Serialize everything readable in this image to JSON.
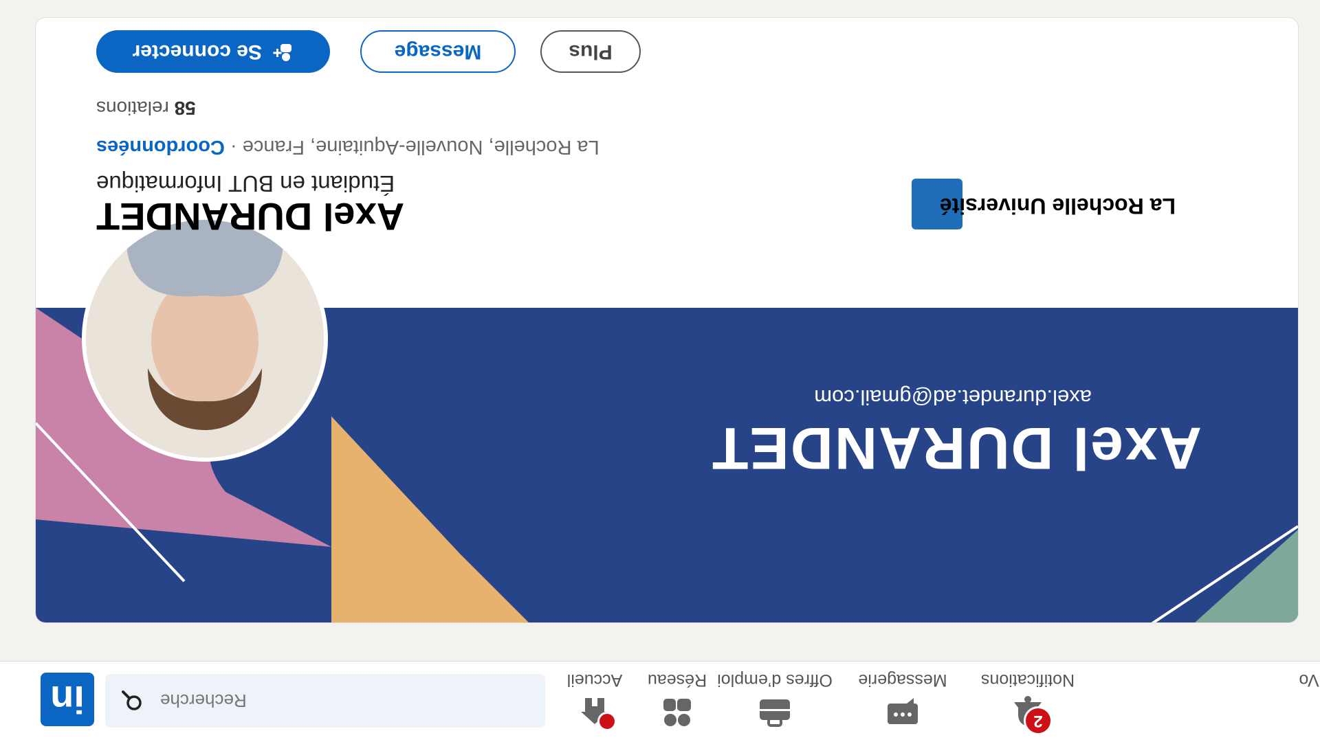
{
  "nav": {
    "logo_text": "in",
    "search_placeholder": "Recherche",
    "items": [
      {
        "label": "Accueil",
        "icon": "home-icon",
        "badge": "dot"
      },
      {
        "label": "Réseau",
        "icon": "network-icon"
      },
      {
        "label": "Offres d’emploi",
        "icon": "briefcase-icon"
      },
      {
        "label": "Messagerie",
        "icon": "messaging-icon"
      },
      {
        "label": "Notifications",
        "icon": "bell-icon",
        "badge": "2"
      },
      {
        "label": "Vo"
      }
    ]
  },
  "banner": {
    "name": "Axel DURANDET",
    "email": "axel.durandet.ad@gmail.com"
  },
  "profile": {
    "name": "Axel DURANDET",
    "headline": "Étudiant en BUT Informatique",
    "location": "La Rochelle, Nouvelle-Aquitaine, France",
    "separator": " · ",
    "contact_link": "Coordonnées",
    "relations_count": "58",
    "relations_label": " relations",
    "education": "La Rochelle Université"
  },
  "actions": {
    "connect": "Se connecter",
    "message": "Message",
    "more": "Plus"
  },
  "colors": {
    "brand": "#0a66c2",
    "banner": "#264487",
    "badge": "#cc1016"
  }
}
